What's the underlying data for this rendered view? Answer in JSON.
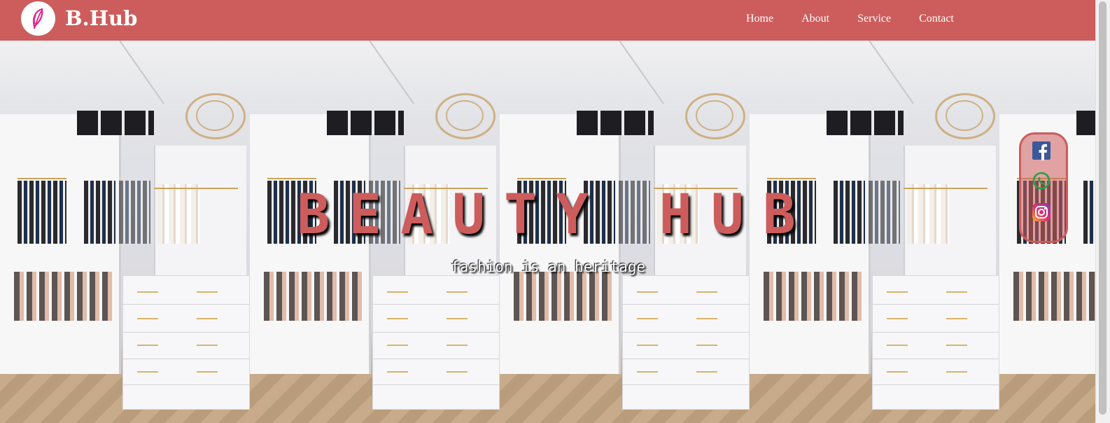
{
  "brand": {
    "name": "B.Hub",
    "logo_icon": "feather-icon",
    "logo_color": "#e0208c"
  },
  "nav": {
    "items": [
      {
        "label": "Home"
      },
      {
        "label": "About"
      },
      {
        "label": "Service"
      },
      {
        "label": "Contact"
      }
    ]
  },
  "hero": {
    "title": "BEAUTY HUB",
    "subtitle": "fashion is an heritage",
    "background": "walk-in closet photo (repeated)"
  },
  "social": {
    "items": [
      {
        "name": "facebook-icon",
        "color": "#3b5998"
      },
      {
        "name": "whatsapp-icon",
        "color": "#25a244"
      },
      {
        "name": "instagram-icon",
        "color": "#d6249f"
      }
    ]
  },
  "colors": {
    "accent": "#cd5c5c",
    "text_light": "#ffffff"
  }
}
